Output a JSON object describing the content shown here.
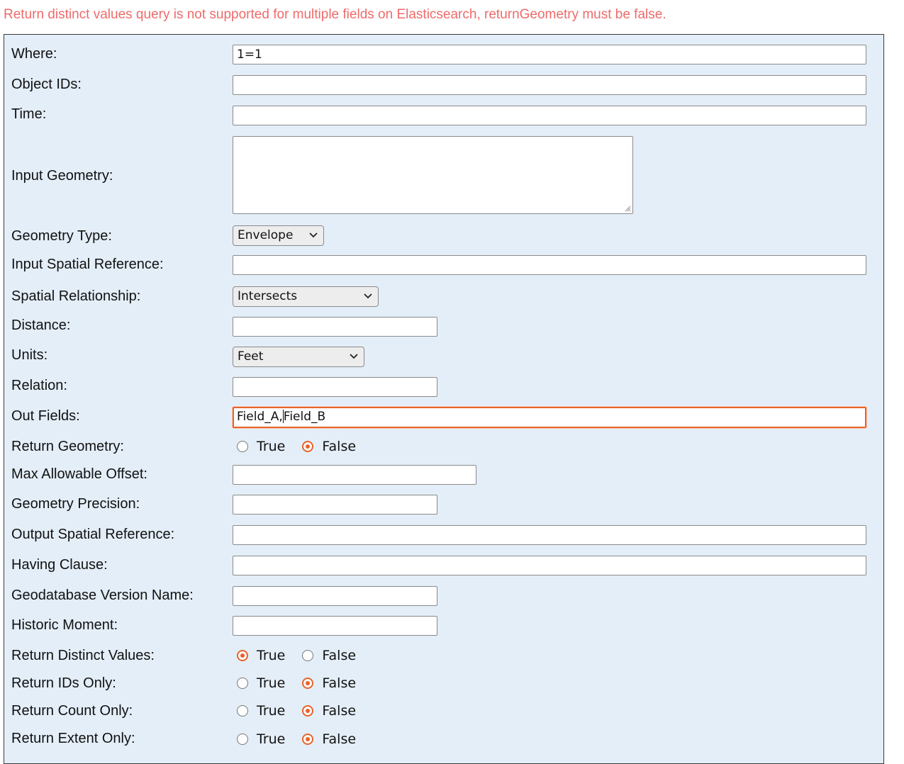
{
  "error_message": "Return distinct values query is not supported for multiple fields on Elasticsearch, returnGeometry must be false.",
  "accent_color": "#e8632a",
  "error_color": "#f06a6a",
  "form": {
    "where": {
      "label": "Where:",
      "value": "1=1"
    },
    "object_ids": {
      "label": "Object IDs:",
      "value": ""
    },
    "time": {
      "label": "Time:",
      "value": ""
    },
    "input_geometry": {
      "label": "Input Geometry:",
      "value": ""
    },
    "geometry_type": {
      "label": "Geometry Type:",
      "selected": "Envelope"
    },
    "input_spatial_reference": {
      "label": "Input Spatial Reference:",
      "value": ""
    },
    "spatial_relationship": {
      "label": "Spatial Relationship:",
      "selected": "Intersects"
    },
    "distance": {
      "label": "Distance:",
      "value": ""
    },
    "units": {
      "label": "Units:",
      "selected": "Feet"
    },
    "relation": {
      "label": "Relation:",
      "value": ""
    },
    "out_fields": {
      "label": "Out Fields:",
      "value_before_caret": "Field_A,",
      "value_after_caret": "Field_B"
    },
    "return_geometry": {
      "label": "Return Geometry:",
      "true_label": "True",
      "false_label": "False",
      "selected": "False"
    },
    "max_allowable_offset": {
      "label": "Max Allowable Offset:",
      "value": ""
    },
    "geometry_precision": {
      "label": "Geometry Precision:",
      "value": ""
    },
    "output_spatial_reference": {
      "label": "Output Spatial Reference:",
      "value": ""
    },
    "having_clause": {
      "label": "Having Clause:",
      "value": ""
    },
    "geodatabase_version_name": {
      "label": "Geodatabase Version Name:",
      "value": ""
    },
    "historic_moment": {
      "label": "Historic Moment:",
      "value": ""
    },
    "return_distinct_values": {
      "label": "Return Distinct Values:",
      "true_label": "True",
      "false_label": "False",
      "selected": "True"
    },
    "return_ids_only": {
      "label": "Return IDs Only:",
      "true_label": "True",
      "false_label": "False",
      "selected": "False"
    },
    "return_count_only": {
      "label": "Return Count Only:",
      "true_label": "True",
      "false_label": "False",
      "selected": "False"
    },
    "return_extent_only": {
      "label": "Return Extent Only:",
      "true_label": "True",
      "false_label": "False",
      "selected": "False"
    }
  }
}
